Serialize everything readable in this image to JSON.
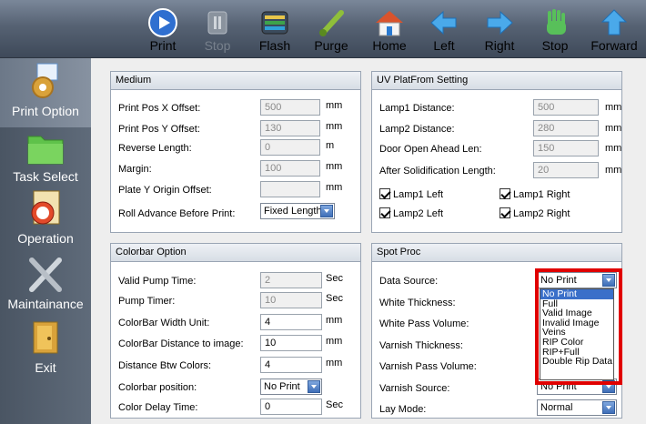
{
  "toolbar": {
    "print": "Print",
    "stop_disabled": "Stop",
    "flash": "Flash",
    "purge": "Purge",
    "home": "Home",
    "left": "Left",
    "right": "Right",
    "stop": "Stop",
    "forward": "Forward"
  },
  "sidebar": {
    "print_option": "Print Option",
    "task_select": "Task Select",
    "operation": "Operation",
    "maintainance": "Maintainance",
    "exit": "Exit"
  },
  "medium": {
    "title": "Medium",
    "x_offset_label": "Print Pos X Offset:",
    "x_offset_value": "500",
    "x_offset_unit": "mm",
    "y_offset_label": "Print Pos Y Offset:",
    "y_offset_value": "130",
    "y_offset_unit": "mm",
    "reverse_label": "Reverse Length:",
    "reverse_value": "0",
    "reverse_unit": "m",
    "margin_label": "Margin:",
    "margin_value": "100",
    "margin_unit": "mm",
    "plate_label": "Plate Y Origin Offset:",
    "plate_value": "",
    "plate_unit": "mm",
    "roll_label": "Roll Advance Before Print:",
    "roll_value": "Fixed Length"
  },
  "uv": {
    "title": "UV PlatFrom Setting",
    "lamp1_label": "Lamp1 Distance:",
    "lamp1_value": "500",
    "lamp1_unit": "mm",
    "lamp2_label": "Lamp2 Distance:",
    "lamp2_value": "280",
    "lamp2_unit": "mm",
    "door_label": "Door Open Ahead Len:",
    "door_value": "150",
    "door_unit": "mm",
    "after_label": "After Solidification Length:",
    "after_value": "20",
    "after_unit": "mm",
    "lamp1_left": "Lamp1 Left",
    "lamp1_right": "Lamp1 Right",
    "lamp2_left": "Lamp2 Left",
    "lamp2_right": "Lamp2 Right"
  },
  "colorbar": {
    "title": "Colorbar Option",
    "pump_time_label": "Valid Pump Time:",
    "pump_time_value": "2",
    "pump_time_unit": "Sec",
    "pump_timer_label": "Pump Timer:",
    "pump_timer_value": "10",
    "pump_timer_unit": "Sec",
    "width_label": "ColorBar Width Unit:",
    "width_value": "4",
    "width_unit": "mm",
    "distance_label": "ColorBar Distance to image:",
    "distance_value": "10",
    "distance_unit": "mm",
    "btw_label": "Distance Btw Colors:",
    "btw_value": "4",
    "btw_unit": "mm",
    "position_label": "Colorbar position:",
    "position_value": "No Print",
    "delay_label": "Color Delay Time:",
    "delay_value": "0",
    "delay_unit": "Sec"
  },
  "spot": {
    "title": "Spot Proc",
    "data_source_label": "Data Source:",
    "data_source_value": "No Print",
    "white_thick_label": "White Thickness:",
    "white_pass_label": "White Pass Volume:",
    "varnish_thick_label": "Varnish Thickness:",
    "varnish_pass_label": "Varnish Pass Volume:",
    "varnish_source_label": "Varnish Source:",
    "varnish_source_value": "No Print",
    "lay_mode_label": "Lay Mode:",
    "lay_mode_value": "Normal",
    "options": [
      "No Print",
      "Full",
      "Valid Image",
      "Invalid Image",
      "Veins",
      "RIP Color",
      "RIP+Full",
      "Double Rip Data"
    ]
  }
}
